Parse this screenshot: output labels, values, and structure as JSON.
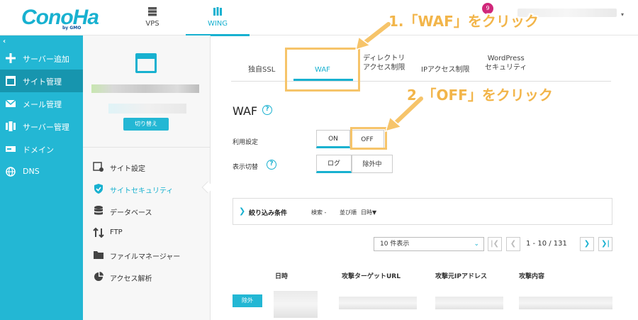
{
  "header": {
    "logo_text": "ConoHa",
    "logo_sub": "by GMO",
    "tabs": [
      {
        "label": "VPS",
        "icon": "server-icon"
      },
      {
        "label": "WING",
        "icon": "wing-icon"
      }
    ],
    "notification_count": "9"
  },
  "sidebar": {
    "collapse_icon": "chevron-left-icon",
    "items": [
      {
        "label": "サーバー追加",
        "icon": "plus-icon"
      },
      {
        "label": "サイト管理",
        "icon": "window-icon",
        "active": true
      },
      {
        "label": "メール管理",
        "icon": "mail-icon"
      },
      {
        "label": "サーバー管理",
        "icon": "server-stack-icon"
      },
      {
        "label": "ドメイン",
        "icon": "domain-icon"
      },
      {
        "label": "DNS",
        "icon": "globe-icon"
      }
    ]
  },
  "site_panel": {
    "switch_label": "切り替え",
    "menu": [
      {
        "label": "サイト設定",
        "icon": "site-settings-icon"
      },
      {
        "label": "サイトセキュリティ",
        "icon": "shield-check-icon",
        "active": true
      },
      {
        "label": "データベース",
        "icon": "database-icon"
      },
      {
        "label": "FTP",
        "icon": "transfer-icon"
      },
      {
        "label": "ファイルマネージャー",
        "icon": "folder-icon"
      },
      {
        "label": "アクセス解析",
        "icon": "pie-chart-icon"
      }
    ]
  },
  "main": {
    "tabs": [
      {
        "label": "独自SSL"
      },
      {
        "label": "WAF",
        "active": true
      },
      {
        "label_1": "ディレクトリ",
        "label_2": "アクセス制限"
      },
      {
        "label": "IPアクセス制限"
      },
      {
        "label_1": "WordPress",
        "label_2": "セキュリティ"
      }
    ],
    "title": "WAF",
    "usage_label": "利用設定",
    "usage_on": "ON",
    "usage_off": "OFF",
    "display_label": "表示切替",
    "display_log": "ログ",
    "display_excluded": "除外中",
    "filter": {
      "title": "絞り込み条件",
      "search": "検索 -",
      "sort": "並び順",
      "sort_value": "日時▼"
    },
    "page_size": "10 件表示",
    "pagination": {
      "first": "|❮",
      "prev": "❮",
      "range": "1 - 10 / 131",
      "next": "❯",
      "last": "❯|"
    },
    "columns": [
      "日時",
      "攻撃ターゲットURL",
      "攻撃元IPアドレス",
      "攻撃内容"
    ],
    "row_badge": "除外"
  },
  "annotations": {
    "step1": "1.「WAF」をクリック",
    "step2": "2.「OFF」をクリック",
    "color": "#f6c46a"
  }
}
